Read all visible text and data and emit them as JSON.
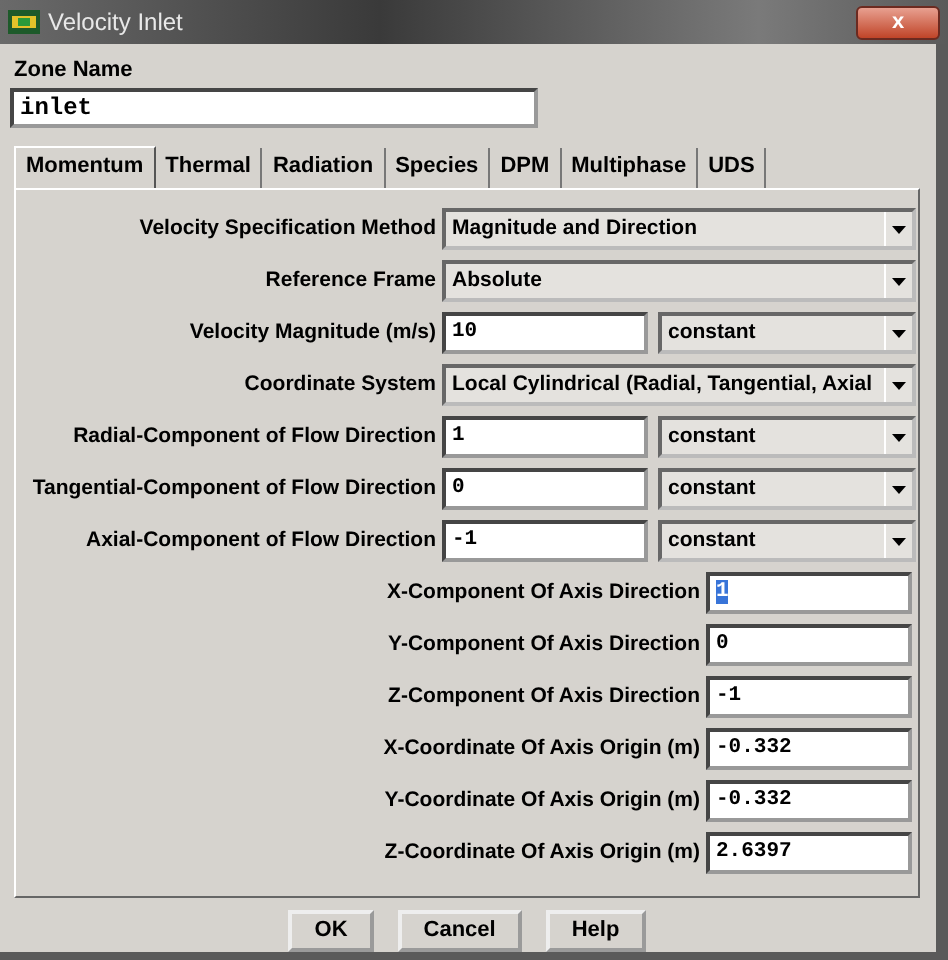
{
  "window": {
    "title": "Velocity Inlet",
    "close_label": "x"
  },
  "zone_name": {
    "label": "Zone Name",
    "value": "inlet"
  },
  "tabs": [
    {
      "label": "Momentum",
      "selected": true
    },
    {
      "label": "Thermal",
      "selected": false
    },
    {
      "label": "Radiation",
      "selected": false
    },
    {
      "label": "Species",
      "selected": false
    },
    {
      "label": "DPM",
      "selected": false
    },
    {
      "label": "Multiphase",
      "selected": false
    },
    {
      "label": "UDS",
      "selected": false
    }
  ],
  "rows": [
    {
      "kind": "select",
      "label": "Velocity Specification Method",
      "option": "Magnitude and Direction"
    },
    {
      "kind": "select",
      "label": "Reference Frame",
      "option": "Absolute"
    },
    {
      "kind": "value_select",
      "label": "Velocity Magnitude (m/s)",
      "value": "10",
      "option": "constant"
    },
    {
      "kind": "select",
      "label": "Coordinate System",
      "option": "Local Cylindrical (Radial, Tangential, Axial"
    },
    {
      "kind": "value_select",
      "label": "Radial-Component of Flow Direction",
      "value": "1",
      "option": "constant"
    },
    {
      "kind": "value_select",
      "label": "Tangential-Component of Flow Direction",
      "value": "0",
      "option": "constant"
    },
    {
      "kind": "value_select",
      "label": "Axial-Component of Flow Direction",
      "value": "-1",
      "option": "constant"
    },
    {
      "kind": "value",
      "label": "X-Component Of Axis Direction",
      "value": "1",
      "highlighted": true
    },
    {
      "kind": "value",
      "label": "Y-Component Of Axis Direction",
      "value": "0",
      "highlighted": false
    },
    {
      "kind": "value",
      "label": "Z-Component Of Axis Direction",
      "value": "-1",
      "highlighted": false
    },
    {
      "kind": "value",
      "label": "X-Coordinate Of Axis Origin (m)",
      "value": "-0.332",
      "highlighted": false
    },
    {
      "kind": "value",
      "label": "Y-Coordinate Of Axis Origin (m)",
      "value": "-0.332",
      "highlighted": false
    },
    {
      "kind": "value",
      "label": "Z-Coordinate Of Axis Origin (m)",
      "value": "2.6397",
      "highlighted": false
    }
  ],
  "buttons": [
    "OK",
    "Cancel",
    "Help"
  ]
}
